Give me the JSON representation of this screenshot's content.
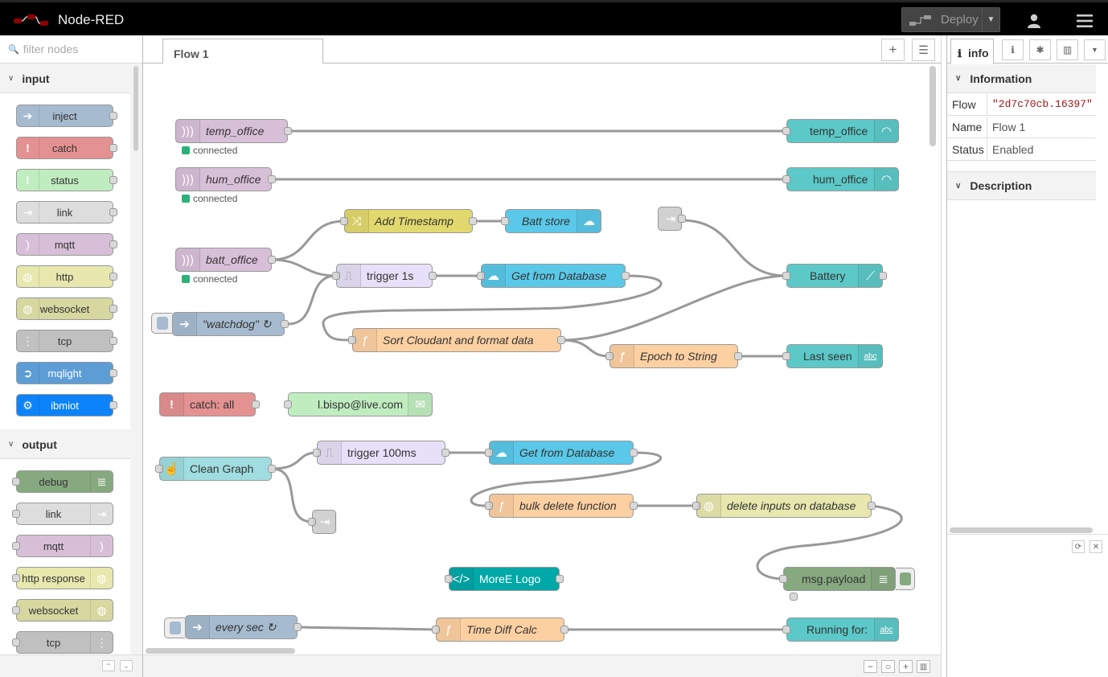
{
  "header": {
    "app_title": "Node-RED",
    "deploy_label": "Deploy"
  },
  "palette": {
    "filter_placeholder": "filter nodes",
    "categories": [
      {
        "label": "input",
        "nodes": [
          {
            "label": "inject",
            "color": "#a6bbcf",
            "icon": "arrow-right-icon"
          },
          {
            "label": "catch",
            "color": "#e49191",
            "icon": "exclamation-icon"
          },
          {
            "label": "status",
            "color": "#c0edc0",
            "icon": "exclamation-icon"
          },
          {
            "label": "link",
            "color": "#dddddd",
            "icon": "link-icon"
          },
          {
            "label": "mqtt",
            "color": "#d8bfd8",
            "icon": "wave-icon"
          },
          {
            "label": "http",
            "color": "#e7e7ae",
            "icon": "globe-icon"
          },
          {
            "label": "websocket",
            "color": "#d7d7a0",
            "icon": "globe-icon"
          },
          {
            "label": "tcp",
            "color": "#c0c0c0",
            "icon": "bridge-icon"
          },
          {
            "label": "mqlight",
            "color": "#5c9dd6",
            "icon": "mqlight-icon"
          },
          {
            "label": "ibmiot",
            "color": "#0d83fa",
            "icon": "gear-chip-icon"
          }
        ]
      },
      {
        "label": "output",
        "nodes": [
          {
            "label": "debug",
            "color": "#87a980",
            "icon": "list-icon"
          },
          {
            "label": "link",
            "color": "#dddddd",
            "icon": "link-icon"
          },
          {
            "label": "mqtt",
            "color": "#d8bfd8",
            "icon": "wave-icon"
          },
          {
            "label": "http response",
            "color": "#e7e7ae",
            "icon": "globe-icon"
          },
          {
            "label": "websocket",
            "color": "#d7d7a0",
            "icon": "globe-icon"
          },
          {
            "label": "tcp",
            "color": "#c0c0c0",
            "icon": "bridge-icon"
          }
        ]
      }
    ]
  },
  "workspace": {
    "tab_label": "Flow 1",
    "nodes": [
      {
        "label": "temp_office",
        "status": "connected"
      },
      {
        "label": "temp_office"
      },
      {
        "label": "hum_office",
        "status": "connected"
      },
      {
        "label": "hum_office"
      },
      {
        "label": "Add Timestamp"
      },
      {
        "label": "Batt store"
      },
      {
        "label": "batt_office",
        "status": "connected"
      },
      {
        "label": "trigger 1s"
      },
      {
        "label": "Get from Database"
      },
      {
        "label": "Battery"
      },
      {
        "label": "\"watchdog\" ↻"
      },
      {
        "label": "Sort Cloudant and format data"
      },
      {
        "label": "Epoch to String"
      },
      {
        "label": "Last seen"
      },
      {
        "label": "catch: all"
      },
      {
        "label": "l.bispo@live.com"
      },
      {
        "label": "Clean Graph"
      },
      {
        "label": "trigger 100ms"
      },
      {
        "label": "Get from Database"
      },
      {
        "label": "bulk delete function"
      },
      {
        "label": "delete inputs on database"
      },
      {
        "label": "MoreE Logo"
      },
      {
        "label": "msg.payload"
      },
      {
        "label": "every sec ↻"
      },
      {
        "label": "Time Diff Calc"
      },
      {
        "label": "Running for:"
      }
    ]
  },
  "sidebar": {
    "tab_label": "info",
    "section_information": "Information",
    "section_description": "Description",
    "props": [
      {
        "key": "Flow",
        "value": "\"2d7c70cb.16397\""
      },
      {
        "key": "Name",
        "value": "Flow 1"
      },
      {
        "key": "Status",
        "value": "Enabled"
      }
    ]
  },
  "colors": {
    "header_bg": "#000000",
    "deploy_bg": "#444444",
    "mqtt": "#d8bfd8",
    "dashboard": "#5cc8c8",
    "function": "#fdd0a2",
    "cloudant": "#5ac8e8",
    "trigger": "#e6e0f8",
    "inject": "#a6bbcf",
    "change": "#e2d96e",
    "debug": "#87a980",
    "catch": "#e49191",
    "email": "#c0edc0",
    "template": "#00a8a8"
  }
}
